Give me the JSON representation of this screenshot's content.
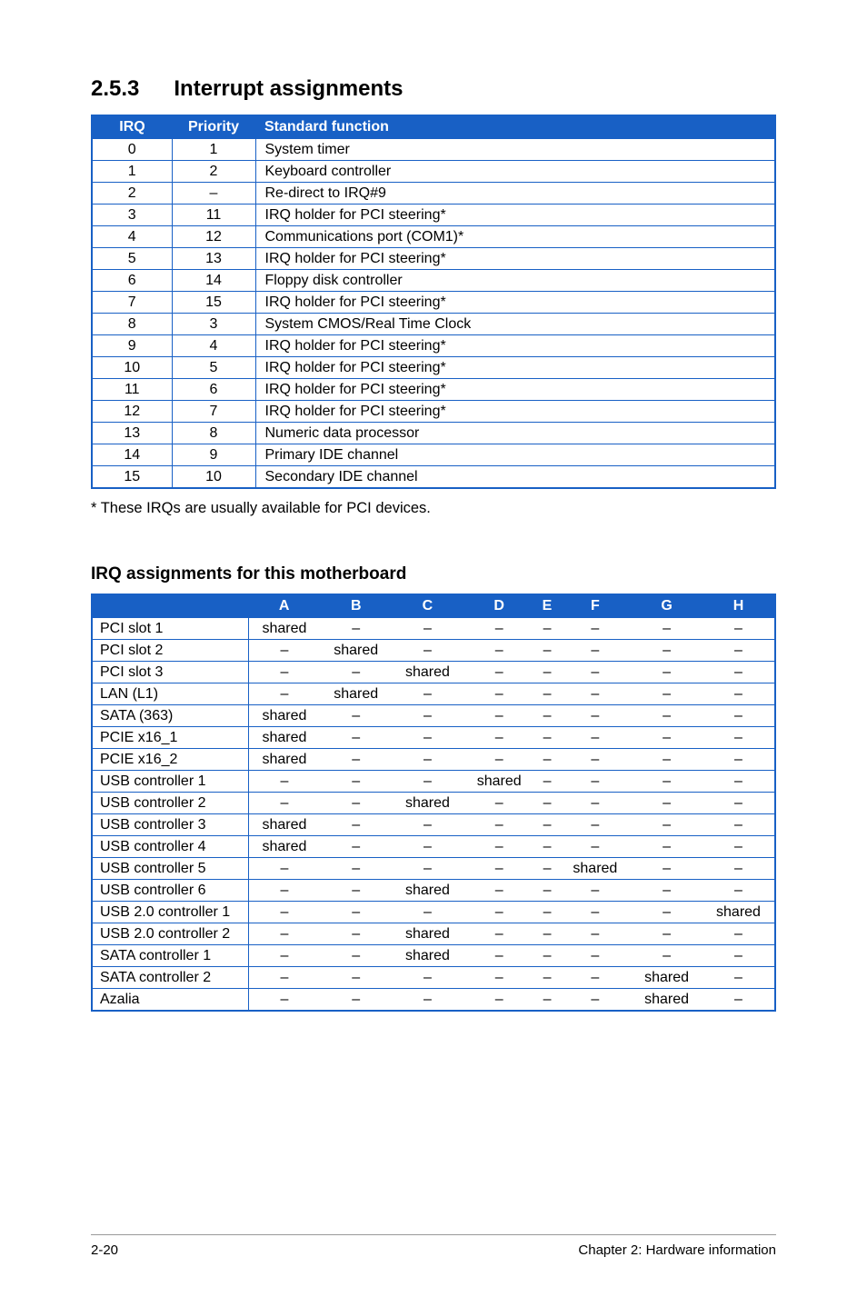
{
  "section": {
    "number": "2.5.3",
    "title": "Interrupt assignments"
  },
  "irq_table": {
    "headers": [
      "IRQ",
      "Priority",
      "Standard function"
    ],
    "rows": [
      {
        "irq": "0",
        "priority": "1",
        "func": "System timer"
      },
      {
        "irq": "1",
        "priority": "2",
        "func": "Keyboard controller"
      },
      {
        "irq": "2",
        "priority": "–",
        "func": "Re-direct to IRQ#9"
      },
      {
        "irq": "3",
        "priority": "11",
        "func": "IRQ holder for PCI steering*"
      },
      {
        "irq": "4",
        "priority": "12",
        "func": "Communications port (COM1)*"
      },
      {
        "irq": "5",
        "priority": "13",
        "func": "IRQ holder for PCI steering*"
      },
      {
        "irq": "6",
        "priority": "14",
        "func": "Floppy disk controller"
      },
      {
        "irq": "7",
        "priority": "15",
        "func": "IRQ holder for PCI steering*"
      },
      {
        "irq": "8",
        "priority": "3",
        "func": "System CMOS/Real Time Clock"
      },
      {
        "irq": "9",
        "priority": "4",
        "func": "IRQ holder for PCI steering*"
      },
      {
        "irq": "10",
        "priority": "5",
        "func": "IRQ holder for PCI steering*"
      },
      {
        "irq": "11",
        "priority": "6",
        "func": "IRQ holder for PCI steering*"
      },
      {
        "irq": "12",
        "priority": "7",
        "func": "IRQ holder for PCI steering*"
      },
      {
        "irq": "13",
        "priority": "8",
        "func": "Numeric data processor"
      },
      {
        "irq": "14",
        "priority": "9",
        "func": "Primary IDE channel"
      },
      {
        "irq": "15",
        "priority": "10",
        "func": "Secondary IDE channel"
      }
    ]
  },
  "note": "* These IRQs are usually available for PCI devices.",
  "subheading": "IRQ assignments for this motherboard",
  "assign_table": {
    "headers": [
      "",
      "A",
      "B",
      "C",
      "D",
      "E",
      "F",
      "G",
      "H"
    ],
    "rows": [
      {
        "name": "PCI slot 1",
        "vals": [
          "shared",
          "–",
          "–",
          "–",
          "–",
          "–",
          "–",
          "–"
        ]
      },
      {
        "name": "PCI slot 2",
        "vals": [
          "–",
          "shared",
          "–",
          "–",
          "–",
          "–",
          "–",
          "–"
        ]
      },
      {
        "name": "PCI slot 3",
        "vals": [
          "–",
          "–",
          "shared",
          "–",
          "–",
          "–",
          "–",
          "–"
        ]
      },
      {
        "name": "LAN (L1)",
        "vals": [
          "–",
          "shared",
          "–",
          "–",
          "–",
          "–",
          "–",
          "–"
        ]
      },
      {
        "name": "SATA (363)",
        "vals": [
          "shared",
          "–",
          "–",
          "–",
          "–",
          "–",
          "–",
          "–"
        ]
      },
      {
        "name": "PCIE x16_1",
        "vals": [
          "shared",
          "–",
          "–",
          "–",
          "–",
          "–",
          "–",
          "–"
        ]
      },
      {
        "name": "PCIE x16_2",
        "vals": [
          "shared",
          "–",
          "–",
          "–",
          "–",
          "–",
          "–",
          "–"
        ]
      },
      {
        "name": "USB controller 1",
        "vals": [
          "–",
          "–",
          "–",
          "shared",
          "–",
          "–",
          "–",
          "–"
        ]
      },
      {
        "name": "USB controller 2",
        "vals": [
          "–",
          "–",
          "shared",
          "–",
          "–",
          "–",
          "–",
          "–"
        ]
      },
      {
        "name": "USB controller 3",
        "vals": [
          "shared",
          "–",
          "–",
          "–",
          "–",
          "–",
          "–",
          "–"
        ]
      },
      {
        "name": "USB controller 4",
        "vals": [
          "shared",
          "–",
          "–",
          "–",
          "–",
          "–",
          "–",
          "–"
        ]
      },
      {
        "name": "USB controller 5",
        "vals": [
          "–",
          "–",
          "–",
          "–",
          "–",
          "shared",
          "–",
          "–"
        ]
      },
      {
        "name": "USB controller 6",
        "vals": [
          "–",
          "–",
          "shared",
          "–",
          "–",
          "–",
          "–",
          "–"
        ]
      },
      {
        "name": "USB 2.0 controller 1",
        "vals": [
          "–",
          "–",
          "–",
          "–",
          "–",
          "–",
          "–",
          "shared"
        ]
      },
      {
        "name": "USB 2.0 controller 2",
        "vals": [
          "–",
          "–",
          "shared",
          "–",
          "–",
          "–",
          "–",
          "–"
        ]
      },
      {
        "name": "SATA controller 1",
        "vals": [
          "–",
          "–",
          "shared",
          "–",
          "–",
          "–",
          "–",
          "–"
        ]
      },
      {
        "name": "SATA controller 2",
        "vals": [
          "–",
          "–",
          "–",
          "–",
          "–",
          "–",
          "shared",
          "–"
        ]
      },
      {
        "name": "Azalia",
        "vals": [
          "–",
          "–",
          "–",
          "–",
          "–",
          "–",
          "shared",
          "–"
        ]
      }
    ]
  },
  "footer": {
    "left": "2-20",
    "right": "Chapter 2: Hardware information"
  }
}
